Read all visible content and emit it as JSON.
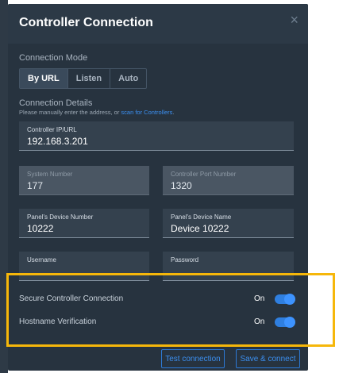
{
  "dialog": {
    "title": "Controller Connection",
    "close_glyph": "×"
  },
  "connection_mode": {
    "label": "Connection Mode",
    "options": [
      "By URL",
      "Listen",
      "Auto"
    ],
    "selected": "By URL"
  },
  "connection_details": {
    "label": "Connection Details",
    "hint_prefix": "Please manually enter the address, or ",
    "hint_link": "scan for Controllers",
    "hint_suffix": "."
  },
  "fields": {
    "controller_ip": {
      "label": "Controller IP/URL",
      "value": "192.168.3.201"
    },
    "system_number": {
      "label": "System Number",
      "value": "177"
    },
    "controller_port": {
      "label": "Controller Port Number",
      "value": "1320"
    },
    "panel_device_number": {
      "label": "Panel's Device Number",
      "value": "10222"
    },
    "panel_device_name": {
      "label": "Panel's Device Name",
      "value": "Device 10222"
    },
    "username": {
      "label": "Username",
      "value": ""
    },
    "password": {
      "label": "Password",
      "value": ""
    }
  },
  "toggles": {
    "secure": {
      "label": "Secure Controller Connection",
      "state": "On"
    },
    "hostname": {
      "label": "Hostname Verification",
      "state": "On"
    }
  },
  "buttons": {
    "test": "Test connection",
    "save": "Save & connect"
  },
  "colors": {
    "dialog_bg": "#27333f",
    "accent": "#2f7fe0",
    "highlight": "#f6b70a"
  }
}
